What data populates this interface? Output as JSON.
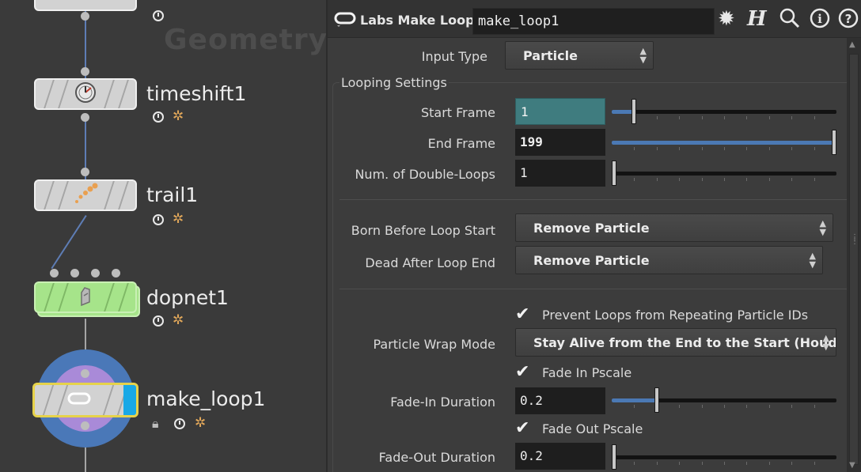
{
  "network": {
    "context_label": "Geometry",
    "nodes": [
      {
        "name": "timeshift1"
      },
      {
        "name": "trail1"
      },
      {
        "name": "dopnet1"
      },
      {
        "name": "make_loop1"
      }
    ]
  },
  "params": {
    "node_type": "Labs Make Loop",
    "node_name": "make_loop1",
    "input_type": {
      "label": "Input Type",
      "value": "Particle"
    },
    "group_title": "Looping Settings",
    "start_frame": {
      "label": "Start Frame",
      "value": "1",
      "slider_fraction": 0.1
    },
    "end_frame": {
      "label": "End Frame",
      "value": "199",
      "slider_fraction": 1.0
    },
    "double_loops": {
      "label": "Num. of Double-Loops",
      "value": "1",
      "slider_fraction": 0.0
    },
    "born_before": {
      "label": "Born Before Loop Start",
      "value": "Remove Particle"
    },
    "dead_after": {
      "label": "Dead After Loop End",
      "value": "Remove Particle"
    },
    "prevent_repeat": {
      "label": "Prevent Loops from Repeating Particle IDs",
      "checked": true
    },
    "wrap_mode": {
      "label": "Particle Wrap Mode",
      "value": "Stay Alive from the End to the Start (Houd…"
    },
    "fade_in_pscale": {
      "label": "Fade In Pscale",
      "checked": true
    },
    "fade_in_duration": {
      "label": "Fade-In Duration",
      "value": "0.2",
      "slider_fraction": 0.2
    },
    "fade_out_pscale": {
      "label": "Fade Out Pscale",
      "checked": true
    },
    "fade_out_duration": {
      "label": "Fade-Out Duration",
      "value": "0.2",
      "slider_fraction": 0.0
    }
  },
  "colors": {
    "accent_blue": "#4b79b4",
    "active_field": "#3f7c7f",
    "dopnet_green": "#a6e48a",
    "selected_border": "#e6d24a",
    "flag_cyan": "#19a8e6",
    "ring_blue": "#4a78b8",
    "ring_purple": "#a98ad8"
  }
}
